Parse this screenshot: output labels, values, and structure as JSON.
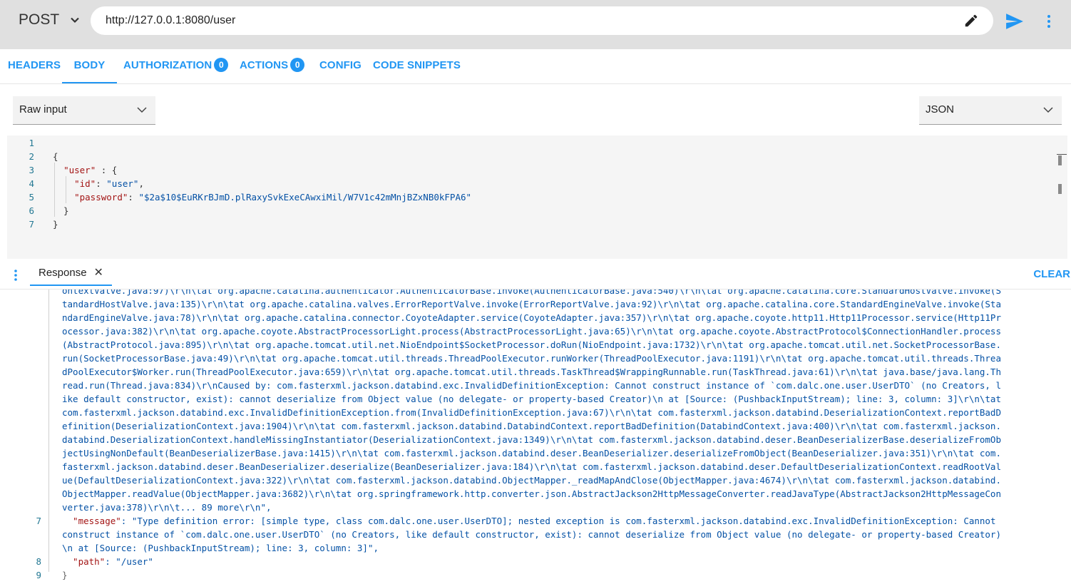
{
  "request": {
    "method": "POST",
    "url": "http://127.0.0.1:8080/user"
  },
  "tabs": [
    {
      "label": "HEADERS"
    },
    {
      "label": "BODY",
      "active": true
    },
    {
      "label": "AUTHORIZATION",
      "badge": "0"
    },
    {
      "label": "ACTIONS",
      "badge": "0"
    },
    {
      "label": "CONFIG"
    },
    {
      "label": "CODE SNIPPETS"
    }
  ],
  "body_mode": {
    "selected": "Raw input"
  },
  "content_type": {
    "selected": "JSON"
  },
  "editor": {
    "lines": [
      {
        "n": "1",
        "parts": []
      },
      {
        "n": "2",
        "parts": [
          [
            "p",
            "{"
          ]
        ]
      },
      {
        "n": "3",
        "parts": [
          [
            "p",
            "  "
          ],
          [
            "k",
            "\"user\""
          ],
          [
            "p",
            " : {"
          ]
        ]
      },
      {
        "n": "4",
        "parts": [
          [
            "p",
            "    "
          ],
          [
            "k",
            "\"id\""
          ],
          [
            "p",
            ": "
          ],
          [
            "s",
            "\"user\""
          ],
          [
            "p",
            ","
          ]
        ]
      },
      {
        "n": "5",
        "parts": [
          [
            "p",
            "    "
          ],
          [
            "k",
            "\"password\""
          ],
          [
            "p",
            ": "
          ],
          [
            "s",
            "\"$2a$10$EuRKrBJmD.plRaxySvkExeCAwxiMil/W7V1c42mMnjBZxNB0kFPA6\""
          ]
        ]
      },
      {
        "n": "6",
        "parts": [
          [
            "p",
            "  }"
          ]
        ]
      },
      {
        "n": "7",
        "parts": [
          [
            "p",
            "}"
          ]
        ]
      }
    ]
  },
  "response": {
    "tab_label": "Response",
    "close_glyph": "✕",
    "clear_label": "CLEAR",
    "lines": [
      {
        "n": "",
        "text": "ontextValve.java:97)\\r\\n\\tat org.apache.catalina.authenticator.AuthenticatorBase.invoke(AuthenticatorBase.java:540)\\r\\n\\tat org.apache.catalina.core.StandardHostValve.invoke(S"
      },
      {
        "n": "",
        "text": "tandardHostValve.java:135)\\r\\n\\tat org.apache.catalina.valves.ErrorReportValve.invoke(ErrorReportValve.java:92)\\r\\n\\tat org.apache.catalina.core.StandardEngineValve.invoke(Sta"
      },
      {
        "n": "",
        "text": "ndardEngineValve.java:78)\\r\\n\\tat org.apache.catalina.connector.CoyoteAdapter.service(CoyoteAdapter.java:357)\\r\\n\\tat org.apache.coyote.http11.Http11Processor.service(Http11Pr"
      },
      {
        "n": "",
        "text": "ocessor.java:382)\\r\\n\\tat org.apache.coyote.AbstractProcessorLight.process(AbstractProcessorLight.java:65)\\r\\n\\tat org.apache.coyote.AbstractProtocol$ConnectionHandler.process"
      },
      {
        "n": "",
        "text": "(AbstractProtocol.java:895)\\r\\n\\tat org.apache.tomcat.util.net.NioEndpoint$SocketProcessor.doRun(NioEndpoint.java:1732)\\r\\n\\tat org.apache.tomcat.util.net.SocketProcessorBase."
      },
      {
        "n": "",
        "text": "run(SocketProcessorBase.java:49)\\r\\n\\tat org.apache.tomcat.util.threads.ThreadPoolExecutor.runWorker(ThreadPoolExecutor.java:1191)\\r\\n\\tat org.apache.tomcat.util.threads.Threa"
      },
      {
        "n": "",
        "text": "dPoolExecutor$Worker.run(ThreadPoolExecutor.java:659)\\r\\n\\tat org.apache.tomcat.util.threads.TaskThread$WrappingRunnable.run(TaskThread.java:61)\\r\\n\\tat java.base/java.lang.Th"
      },
      {
        "n": "",
        "text": "read.run(Thread.java:834)\\r\\nCaused by: com.fasterxml.jackson.databind.exc.InvalidDefinitionException: Cannot construct instance of `com.dalc.one.user.UserDTO` (no Creators, l"
      },
      {
        "n": "",
        "text": "ike default constructor, exist): cannot deserialize from Object value (no delegate- or property-based Creator)\\n at [Source: (PushbackInputStream); line: 3, column: 3]\\r\\n\\tat"
      },
      {
        "n": "",
        "text": "com.fasterxml.jackson.databind.exc.InvalidDefinitionException.from(InvalidDefinitionException.java:67)\\r\\n\\tat com.fasterxml.jackson.databind.DeserializationContext.reportBadD"
      },
      {
        "n": "",
        "text": "efinition(DeserializationContext.java:1904)\\r\\n\\tat com.fasterxml.jackson.databind.DatabindContext.reportBadDefinition(DatabindContext.java:400)\\r\\n\\tat com.fasterxml.jackson."
      },
      {
        "n": "",
        "text": "databind.DeserializationContext.handleMissingInstantiator(DeserializationContext.java:1349)\\r\\n\\tat com.fasterxml.jackson.databind.deser.BeanDeserializerBase.deserializeFromOb"
      },
      {
        "n": "",
        "text": "jectUsingNonDefault(BeanDeserializerBase.java:1415)\\r\\n\\tat com.fasterxml.jackson.databind.deser.BeanDeserializer.deserializeFromObject(BeanDeserializer.java:351)\\r\\n\\tat com."
      },
      {
        "n": "",
        "text": "fasterxml.jackson.databind.deser.BeanDeserializer.deserialize(BeanDeserializer.java:184)\\r\\n\\tat com.fasterxml.jackson.databind.deser.DefaultDeserializationContext.readRootVal"
      },
      {
        "n": "",
        "text": "ue(DefaultDeserializationContext.java:322)\\r\\n\\tat com.fasterxml.jackson.databind.ObjectMapper._readMapAndClose(ObjectMapper.java:4674)\\r\\n\\tat com.fasterxml.jackson.databind."
      },
      {
        "n": "",
        "text": "ObjectMapper.readValue(ObjectMapper.java:3682)\\r\\n\\tat org.springframework.http.converter.json.AbstractJackson2HttpMessageConverter.readJavaType(AbstractJackson2HttpMessageCon"
      },
      {
        "n": "",
        "text": "verter.java:378)\\r\\n\\t... 89 more\\r\\n\","
      },
      {
        "n": "7",
        "key": "  \"message\"",
        "text": ": \"Type definition error: [simple type, class com.dalc.one.user.UserDTO]; nested exception is com.fasterxml.jackson.databind.exc.InvalidDefinitionException: Cannot"
      },
      {
        "n": "",
        "text": "construct instance of `com.dalc.one.user.UserDTO` (no Creators, like default constructor, exist): cannot deserialize from Object value (no delegate- or property-based Creator)"
      },
      {
        "n": "",
        "text": "\\n at [Source: (PushbackInputStream); line: 3, column: 3]\","
      },
      {
        "n": "8",
        "key": "  \"path\"",
        "text": ": \"/user\""
      },
      {
        "n": "9",
        "text": "}"
      }
    ]
  }
}
